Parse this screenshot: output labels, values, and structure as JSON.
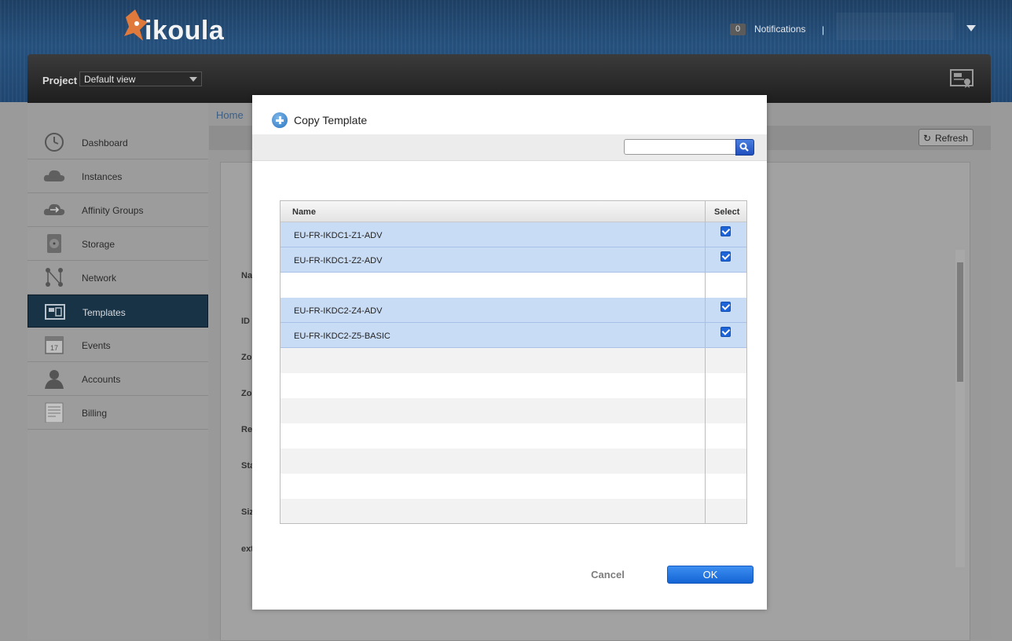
{
  "header": {
    "logo_text": "ikoula",
    "notifications_count": "0",
    "notifications_label": "Notifications",
    "separator": "|"
  },
  "project": {
    "label": "Project",
    "selected": "Default view"
  },
  "sidebar": {
    "items": [
      {
        "label": "Dashboard",
        "icon": "dashboard-icon"
      },
      {
        "label": "Instances",
        "icon": "cloud-icon"
      },
      {
        "label": "Affinity Groups",
        "icon": "affinity-icon"
      },
      {
        "label": "Storage",
        "icon": "storage-icon"
      },
      {
        "label": "Network",
        "icon": "network-icon"
      },
      {
        "label": "Templates",
        "icon": "templates-icon",
        "active": true
      },
      {
        "label": "Events",
        "icon": "calendar-icon"
      },
      {
        "label": "Accounts",
        "icon": "user-icon"
      },
      {
        "label": "Billing",
        "icon": "billing-icon"
      }
    ]
  },
  "main": {
    "breadcrumb": "Home",
    "refresh_label": "Refresh",
    "partial_labels": [
      "Na",
      "ID",
      "Zo",
      "Zo",
      "Re",
      "Sta",
      "Siz",
      "ext"
    ]
  },
  "modal": {
    "title": "Copy Template",
    "search_placeholder": "",
    "columns": {
      "name": "Name",
      "select": "Select"
    },
    "rows": [
      {
        "name": "EU-FR-IKDC1-Z1-ADV",
        "selected": true
      },
      {
        "name": "EU-FR-IKDC1-Z2-ADV",
        "selected": true
      },
      {
        "name": "",
        "selected": false
      },
      {
        "name": "EU-FR-IKDC2-Z4-ADV",
        "selected": true
      },
      {
        "name": "EU-FR-IKDC2-Z5-BASIC",
        "selected": true
      }
    ],
    "cancel_label": "Cancel",
    "ok_label": "OK"
  }
}
